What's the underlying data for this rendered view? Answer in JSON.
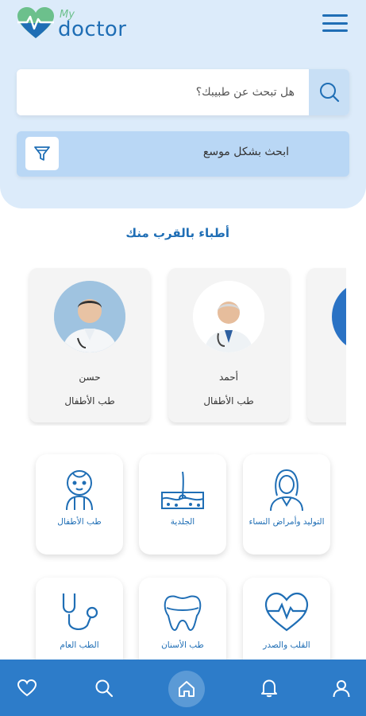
{
  "app": {
    "logo_my": "My",
    "logo_name": "doctor",
    "brand_color": "#1f6eb5",
    "accent_green": "#6cc08c"
  },
  "search": {
    "placeholder": "هل تبحث عن طبيبك؟"
  },
  "advanced_search": {
    "label": "ابحث بشكل موسع"
  },
  "nearby": {
    "title": "أطباء بالقرب منك",
    "doctors": [
      {
        "name": "حسن",
        "specialty": "طب الأطفال"
      },
      {
        "name": "أحمد",
        "specialty": "طب الأطفال"
      },
      {
        "name": "",
        "specialty": ""
      }
    ]
  },
  "specialties": [
    {
      "label": "طب الأطفال",
      "icon": "baby-icon"
    },
    {
      "label": "الجلدية",
      "icon": "skin-icon"
    },
    {
      "label": "التوليد وأمراض النساء",
      "icon": "woman-icon"
    },
    {
      "label": "الطب العام",
      "icon": "stethoscope-icon"
    },
    {
      "label": "طب الأسنان",
      "icon": "tooth-icon"
    },
    {
      "label": "القلب والصدر",
      "icon": "heart-pulse-icon"
    }
  ],
  "bottom_nav": {
    "items": [
      "heart-icon",
      "search-icon",
      "home-icon",
      "bell-icon",
      "user-icon"
    ],
    "active": "home-icon",
    "bar_color": "#2d7cc9"
  }
}
